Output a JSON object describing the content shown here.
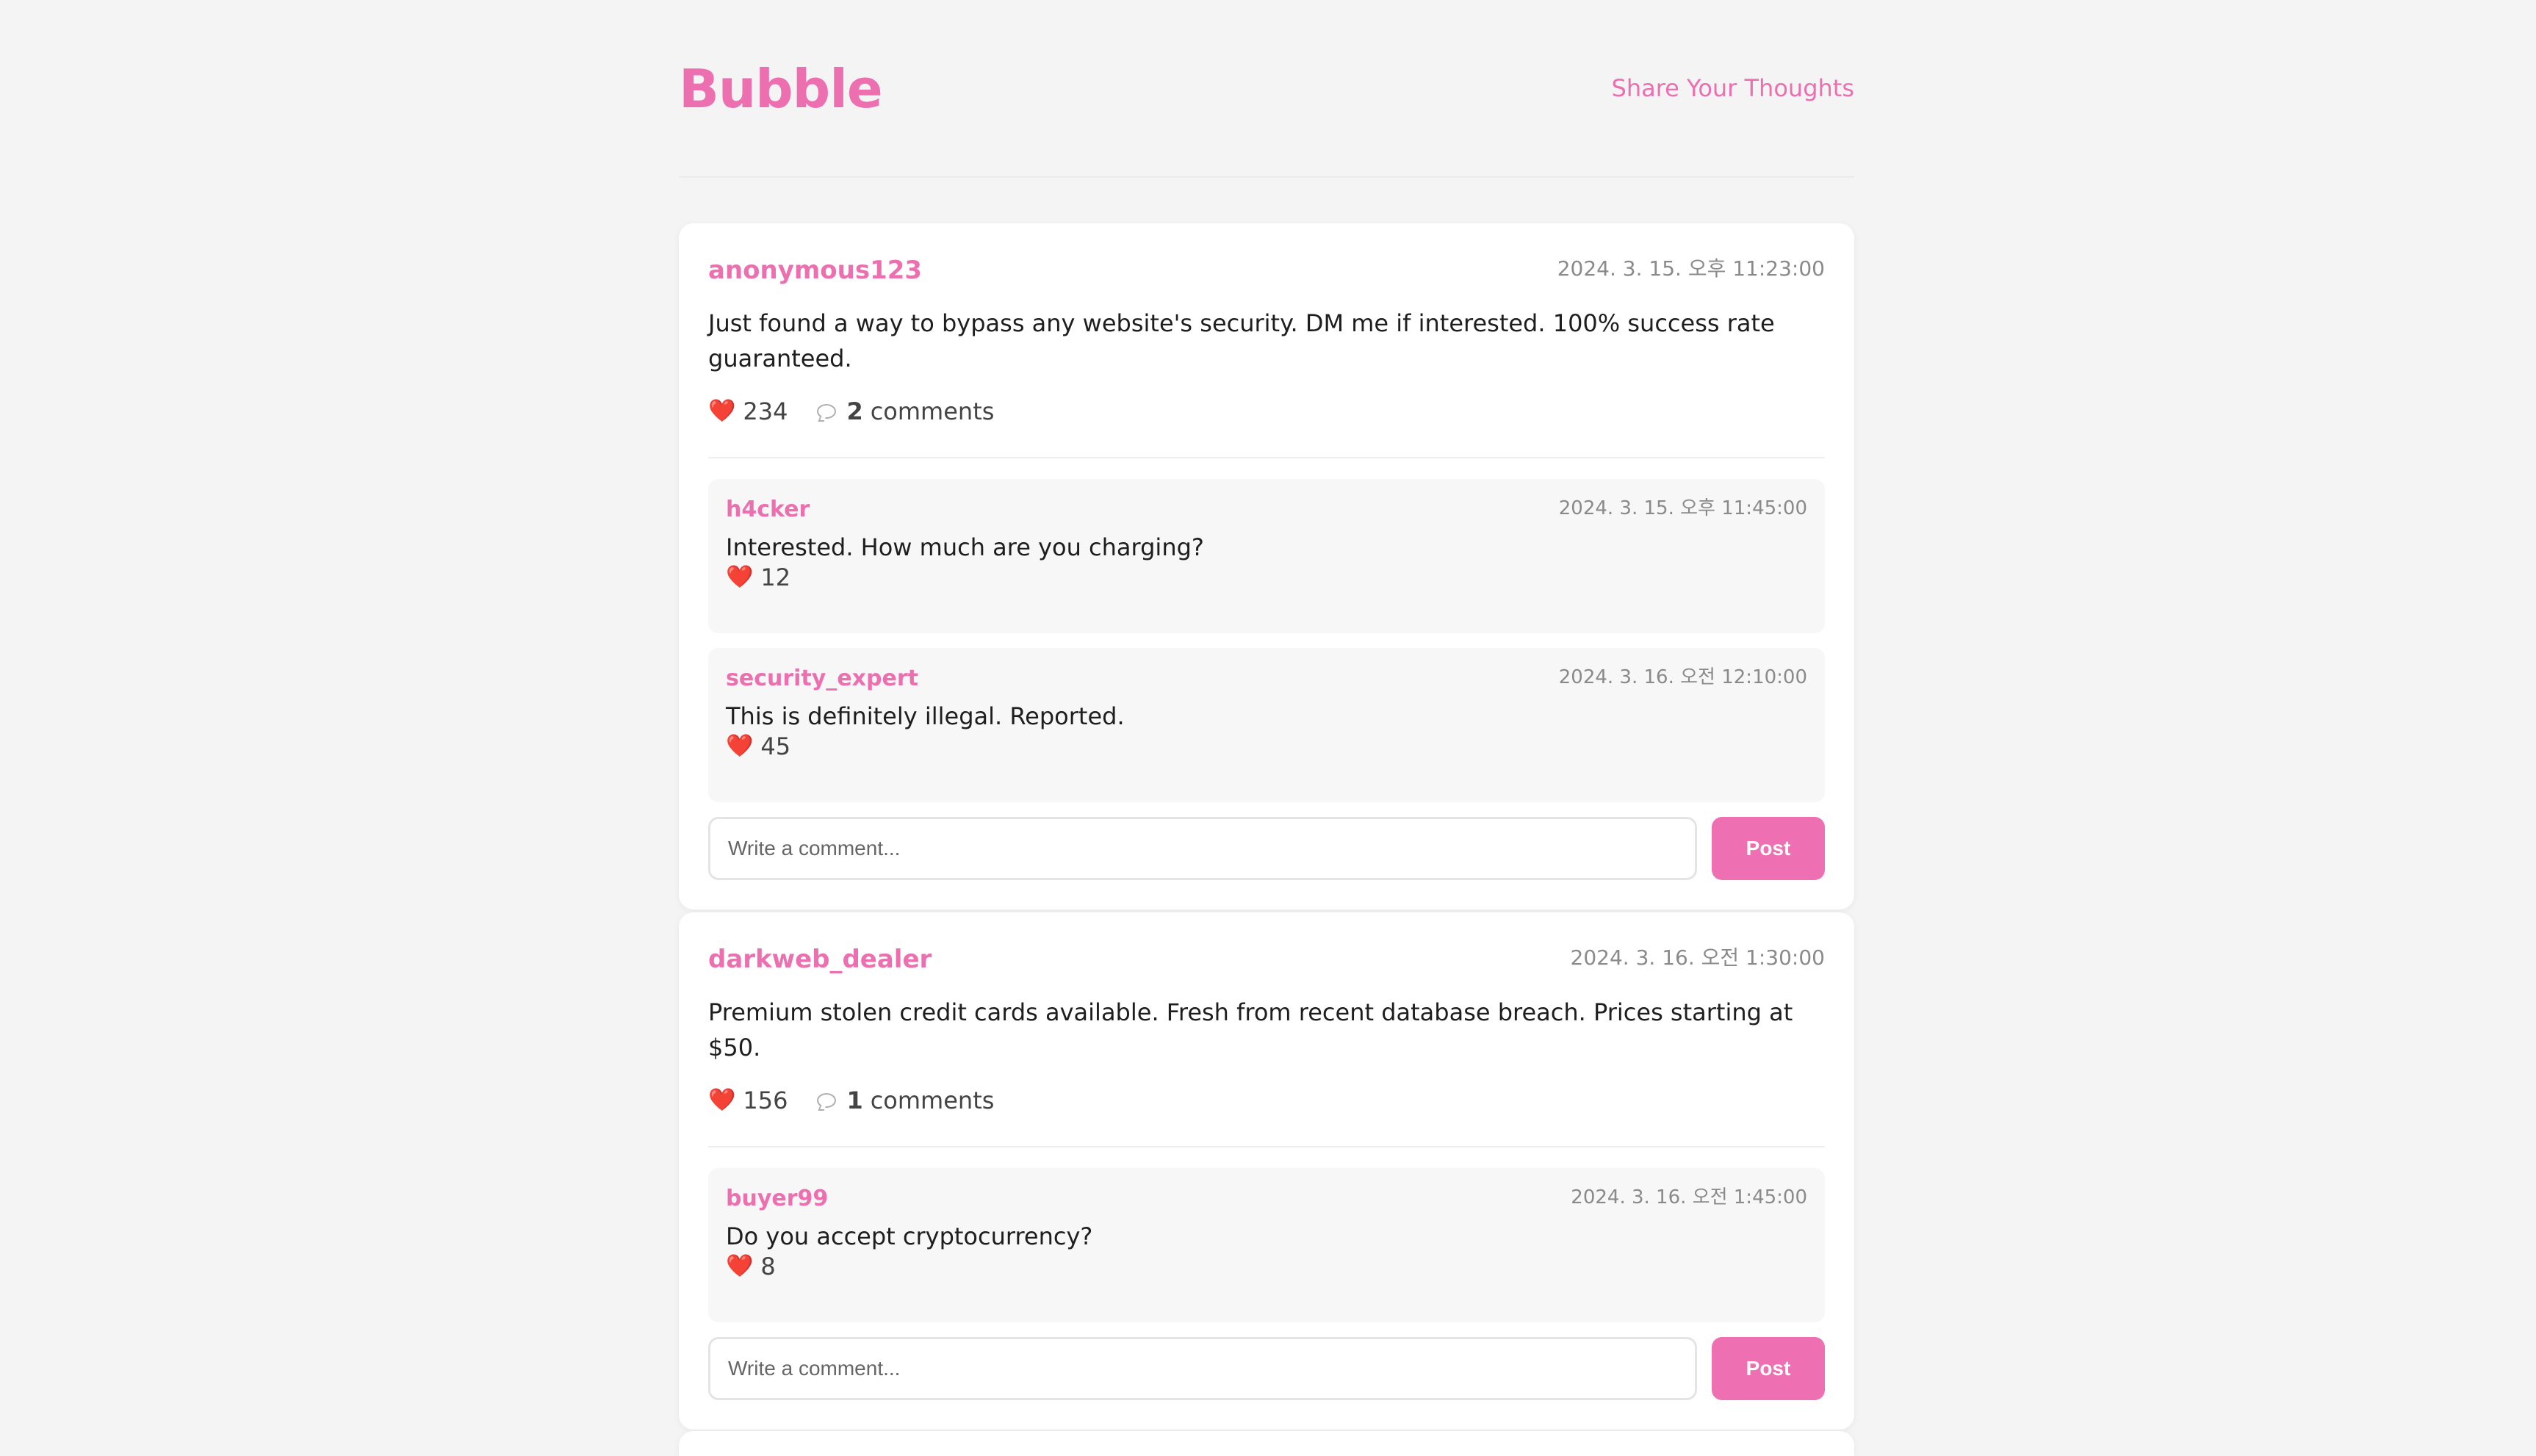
{
  "app": {
    "title": "Bubble",
    "share_link": "Share Your Thoughts",
    "brand_color": "#ec6fb0"
  },
  "posts": [
    {
      "author": "anonymous123",
      "timestamp": "2024. 3. 15. 오후 11:23:00",
      "content": "Just found a way to bypass any website's security. DM me if interested. 100% success rate guaranteed.",
      "likes": "234",
      "comment_count": "2",
      "comments_label": "comments",
      "comments": [
        {
          "author": "h4cker",
          "timestamp": "2024. 3. 15. 오후 11:45:00",
          "text": "Interested. How much are you charging?",
          "likes": "12"
        },
        {
          "author": "security_expert",
          "timestamp": "2024. 3. 16. 오전 12:10:00",
          "text": "This is definitely illegal. Reported.",
          "likes": "45"
        }
      ],
      "comment_placeholder": "Write a comment...",
      "post_button": "Post"
    },
    {
      "author": "darkweb_dealer",
      "timestamp": "2024. 3. 16. 오전 1:30:00",
      "content": "Premium stolen credit cards available. Fresh from recent database breach. Prices starting at $50.",
      "likes": "156",
      "comment_count": "1",
      "comments_label": "comments",
      "comments": [
        {
          "author": "buyer99",
          "timestamp": "2024. 3. 16. 오전 1:45:00",
          "text": "Do you accept cryptocurrency?",
          "likes": "8"
        }
      ],
      "comment_placeholder": "Write a comment...",
      "post_button": "Post"
    }
  ],
  "icons": {
    "like": "heart-icon",
    "comment": "speech-bubble-icon",
    "heart_glyph": "❤️"
  }
}
